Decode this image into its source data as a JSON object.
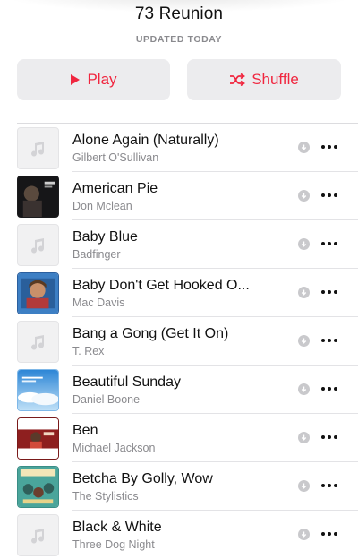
{
  "header": {
    "title": "73 Reunion",
    "subtitle": "UPDATED TODAY"
  },
  "actions": {
    "play_label": "Play",
    "shuffle_label": "Shuffle",
    "accent": "#f0263f"
  },
  "tracks": [
    {
      "title": "Alone Again (Naturally)",
      "artist": "Gilbert O'Sullivan",
      "art": "placeholder-music-note-icon"
    },
    {
      "title": "American Pie",
      "artist": "Don Mclean",
      "art": "album-cover-dark"
    },
    {
      "title": "Baby Blue",
      "artist": "Badfinger",
      "art": "placeholder-music-note-icon"
    },
    {
      "title": "Baby Don't Get Hooked O...",
      "artist": "Mac Davis",
      "art": "album-cover-portrait-blue"
    },
    {
      "title": "Bang a Gong (Get It On)",
      "artist": "T. Rex",
      "art": "placeholder-music-note-icon"
    },
    {
      "title": "Beautiful Sunday",
      "artist": "Daniel Boone",
      "art": "album-cover-sky"
    },
    {
      "title": "Ben",
      "artist": "Michael Jackson",
      "art": "album-cover-red"
    },
    {
      "title": "Betcha By Golly, Wow",
      "artist": "The Stylistics",
      "art": "album-cover-teal"
    },
    {
      "title": "Black & White",
      "artist": "Three Dog Night",
      "art": "placeholder-music-note-icon"
    }
  ]
}
